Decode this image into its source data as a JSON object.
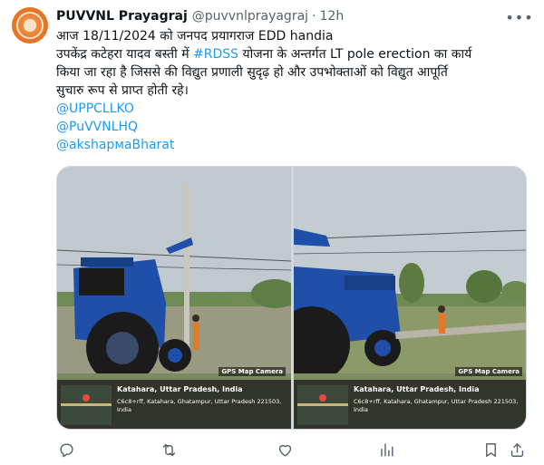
{
  "author": {
    "display_name": "PUVVNL Prayagraj",
    "handle": "@puvvnlprayagraj",
    "separator": "·",
    "time": "12h",
    "avatar_icon": "orange-emblem-avatar"
  },
  "post": {
    "line1": "आज 18/11/2024 को जनपद प्रयागराज EDD handia",
    "line2_before": "उपकेंद्र कटेहरा यादव बस्ती  में ",
    "line2_hashtag": "#RDSS",
    "line2_after": " योजना के अन्तर्गत LT pole erection का कार्य",
    "line3": "किया जा रहा है जिससे की   विद्युत प्रणाली सुदृढ़ हो और उपभोक्ताओं को विद्युत आपूर्ति",
    "line4": "सुचारु रूप से प्राप्त होती रहे।",
    "mentions": [
      "@UPPCLLKO",
      "@PuVVNLHQ",
      "@akshармаBharat"
    ]
  },
  "media": {
    "photos": [
      {
        "gps_tag": "GPS Map Camera",
        "location": "Katahara, Uttar Pradesh, India",
        "address": "C6c8+rff, Katahara, Ghatampur, Uttar Pradesh 221503, India"
      },
      {
        "gps_tag": "GPS Map Camera",
        "location": "Katahara, Uttar Pradesh, India",
        "address": "C6c8+rff, Katahara, Ghatampur, Uttar Pradesh 221503, India"
      }
    ]
  },
  "actions": {
    "icons": [
      "reply-icon",
      "retweet-icon",
      "like-icon",
      "views-icon",
      "bookmark-icon",
      "share-icon"
    ]
  },
  "colors": {
    "link": "#1d9bf0",
    "secondary_text": "#536471",
    "primary_text": "#0f1419",
    "tractor_blue": "#1f4fa8"
  }
}
